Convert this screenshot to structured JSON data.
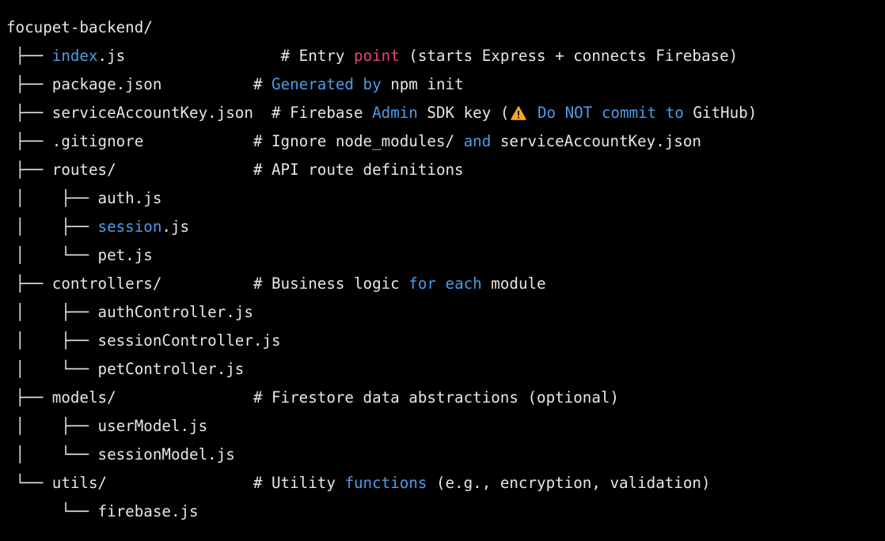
{
  "colors": {
    "background": "#000000",
    "text": "#e6e6e6",
    "keyword_blue": "#4d9ce8",
    "keyword_pink": "#e8457a",
    "warning": "#f5a623"
  },
  "lines": [
    {
      "tree": "",
      "segs": [
        {
          "t": "focupet-backend/",
          "c": "plain"
        }
      ]
    },
    {
      "tree": " ├── ",
      "segs": [
        {
          "t": "index",
          "c": "blue"
        },
        {
          "t": ".js                 # Entry ",
          "c": "plain"
        },
        {
          "t": "point",
          "c": "pink"
        },
        {
          "t": " (starts Express + connects Firebase)",
          "c": "plain"
        }
      ]
    },
    {
      "tree": " ├── ",
      "segs": [
        {
          "t": "package.json          # ",
          "c": "plain"
        },
        {
          "t": "Generated",
          "c": "blue"
        },
        {
          "t": " ",
          "c": "plain"
        },
        {
          "t": "by",
          "c": "blue"
        },
        {
          "t": " npm init",
          "c": "plain"
        }
      ]
    },
    {
      "tree": " ├── ",
      "segs": [
        {
          "t": "serviceAccountKey.json  # Firebase ",
          "c": "plain"
        },
        {
          "t": "Admin",
          "c": "blue"
        },
        {
          "t": " SDK key (",
          "c": "plain"
        },
        {
          "icon": "warning-icon"
        },
        {
          "t": " ",
          "c": "plain"
        },
        {
          "t": "Do",
          "c": "blue"
        },
        {
          "t": " ",
          "c": "plain"
        },
        {
          "t": "NOT",
          "c": "blue"
        },
        {
          "t": " ",
          "c": "plain"
        },
        {
          "t": "commit",
          "c": "blue"
        },
        {
          "t": " ",
          "c": "plain"
        },
        {
          "t": "to",
          "c": "blue"
        },
        {
          "t": " GitHub)",
          "c": "plain"
        }
      ]
    },
    {
      "tree": " ├── ",
      "segs": [
        {
          "t": ".gitignore            # Ignore node_modules/ ",
          "c": "plain"
        },
        {
          "t": "and",
          "c": "blue"
        },
        {
          "t": " serviceAccountKey.json",
          "c": "plain"
        }
      ]
    },
    {
      "tree": " ├── ",
      "segs": [
        {
          "t": "routes/               # API route definitions",
          "c": "plain"
        }
      ]
    },
    {
      "tree": " │    ├── ",
      "segs": [
        {
          "t": "auth.js",
          "c": "plain"
        }
      ]
    },
    {
      "tree": " │    ├── ",
      "segs": [
        {
          "t": "session",
          "c": "blue"
        },
        {
          "t": ".js",
          "c": "plain"
        }
      ]
    },
    {
      "tree": " │    └── ",
      "segs": [
        {
          "t": "pet.js",
          "c": "plain"
        }
      ]
    },
    {
      "tree": " ├── ",
      "segs": [
        {
          "t": "controllers/          # Business logic ",
          "c": "plain"
        },
        {
          "t": "for",
          "c": "blue"
        },
        {
          "t": " ",
          "c": "plain"
        },
        {
          "t": "each",
          "c": "blue"
        },
        {
          "t": " module",
          "c": "plain"
        }
      ]
    },
    {
      "tree": " │    ├── ",
      "segs": [
        {
          "t": "authController.js",
          "c": "plain"
        }
      ]
    },
    {
      "tree": " │    ├── ",
      "segs": [
        {
          "t": "sessionController.js",
          "c": "plain"
        }
      ]
    },
    {
      "tree": " │    └── ",
      "segs": [
        {
          "t": "petController.js",
          "c": "plain"
        }
      ]
    },
    {
      "tree": " ├── ",
      "segs": [
        {
          "t": "models/               # Firestore data abstractions (optional)",
          "c": "plain"
        }
      ]
    },
    {
      "tree": " │    ├── ",
      "segs": [
        {
          "t": "userModel.js",
          "c": "plain"
        }
      ]
    },
    {
      "tree": " │    └── ",
      "segs": [
        {
          "t": "sessionModel.js",
          "c": "plain"
        }
      ]
    },
    {
      "tree": " └── ",
      "segs": [
        {
          "t": "utils/                # Utility ",
          "c": "plain"
        },
        {
          "t": "functions",
          "c": "blue"
        },
        {
          "t": " (e.g., encryption, validation)",
          "c": "plain"
        }
      ]
    },
    {
      "tree": "      └── ",
      "segs": [
        {
          "t": "firebase.js",
          "c": "plain"
        }
      ]
    }
  ]
}
